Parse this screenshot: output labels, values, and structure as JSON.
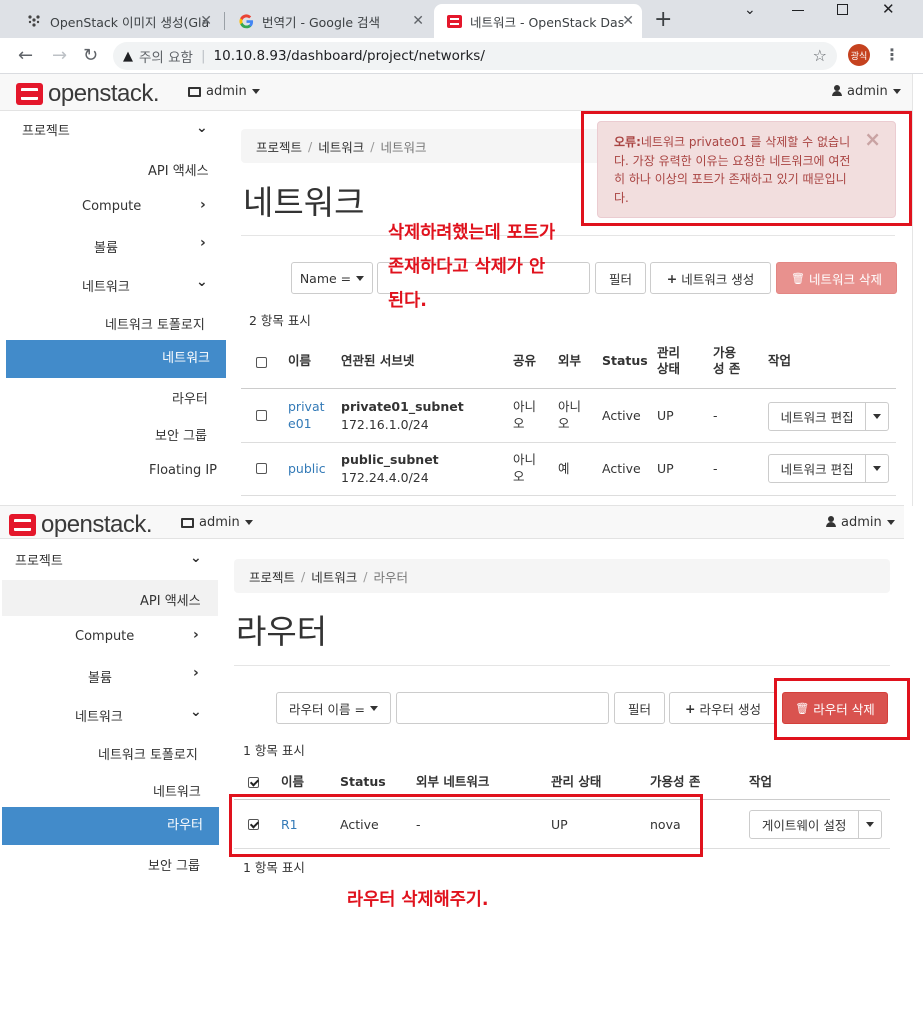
{
  "browser": {
    "tabs": [
      {
        "title": "OpenStack 이미지 생성(Gla",
        "icon": "openstack-community-icon"
      },
      {
        "title": "번역기 - Google 검색",
        "icon": "google-icon"
      },
      {
        "title": "네트워크 - OpenStack Das",
        "icon": "openstack-icon"
      }
    ],
    "address": {
      "security": "주의 요함",
      "url": "10.10.8.93/dashboard/project/networks/"
    },
    "profile_initials": "광식"
  },
  "top_panel": {
    "brand": "openstack.",
    "project": "admin",
    "user": "admin",
    "sidebar": {
      "project": "프로젝트",
      "api_access": "API 액세스",
      "compute": "Compute",
      "volume": "볼륨",
      "network": "네트워크",
      "network_topology": "네트워크 토폴로지",
      "networks": "네트워크",
      "routers": "라우터",
      "security_groups": "보안 그룹",
      "floating_ip": "Floating IP"
    },
    "breadcrumb": [
      "프로젝트",
      "네트워크",
      "네트워크"
    ],
    "title": "네트워크",
    "filter": {
      "field": "Name =",
      "filter_btn": "필터",
      "create_btn": "네트워크 생성",
      "delete_btn": "네트워크 삭제"
    },
    "count": "2 항목 표시",
    "columns": [
      "이름",
      "연관된 서브넷",
      "공유",
      "외부",
      "Status",
      "관리 상태",
      "가용성 존",
      "작업"
    ],
    "rows": [
      {
        "name": "private01",
        "subnet": "private01_subnet",
        "cidr": "172.16.1.0/24",
        "shared": "아니오",
        "external": "아니오",
        "status": "Active",
        "admin_state": "UP",
        "az": "-",
        "action": "네트워크 편집"
      },
      {
        "name": "public",
        "subnet": "public_subnet",
        "cidr": "172.24.4.0/24",
        "shared": "아니오",
        "external": "예",
        "status": "Active",
        "admin_state": "UP",
        "az": "-",
        "action": "네트워크 편집"
      }
    ],
    "alert": {
      "prefix": "오류:",
      "message": "네트워크 private01 를 삭제할 수 없습니다. 가장 유력한 이유는 요청한 네트워크에 여전히 하나 이상의 포트가 존재하고 있기 때문입니다."
    }
  },
  "annotation_top": [
    "삭제하려했는데 포트가",
    "존재하다고 삭제가 안",
    "된다."
  ],
  "bottom_panel": {
    "brand": "openstack.",
    "project": "admin",
    "user": "admin",
    "sidebar": {
      "project": "프로젝트",
      "api_access": "API 액세스",
      "compute": "Compute",
      "volume": "볼륨",
      "network": "네트워크",
      "network_topology": "네트워크 토폴로지",
      "networks": "네트워크",
      "routers": "라우터",
      "security_groups": "보안 그룹"
    },
    "breadcrumb": [
      "프로젝트",
      "네트워크",
      "라우터"
    ],
    "title": "라우터",
    "filter": {
      "field": "라우터 이름 =",
      "filter_btn": "필터",
      "create_btn": "라우터 생성",
      "delete_btn": "라우터 삭제"
    },
    "count": "1 항목 표시",
    "count_bottom": "1 항목 표시",
    "columns": [
      "이름",
      "Status",
      "외부 네트워크",
      "관리 상태",
      "가용성 존",
      "작업"
    ],
    "rows": [
      {
        "name": "R1",
        "status": "Active",
        "external_network": "-",
        "admin_state": "UP",
        "az": "nova",
        "action": "게이트웨이 설정",
        "checked": true
      }
    ]
  },
  "annotation_bottom": "라우터 삭제해주기.",
  "colors": {
    "accent": "#428bca",
    "danger": "#d9534f",
    "annotation": "#e0121d",
    "link": "#337ab7"
  }
}
